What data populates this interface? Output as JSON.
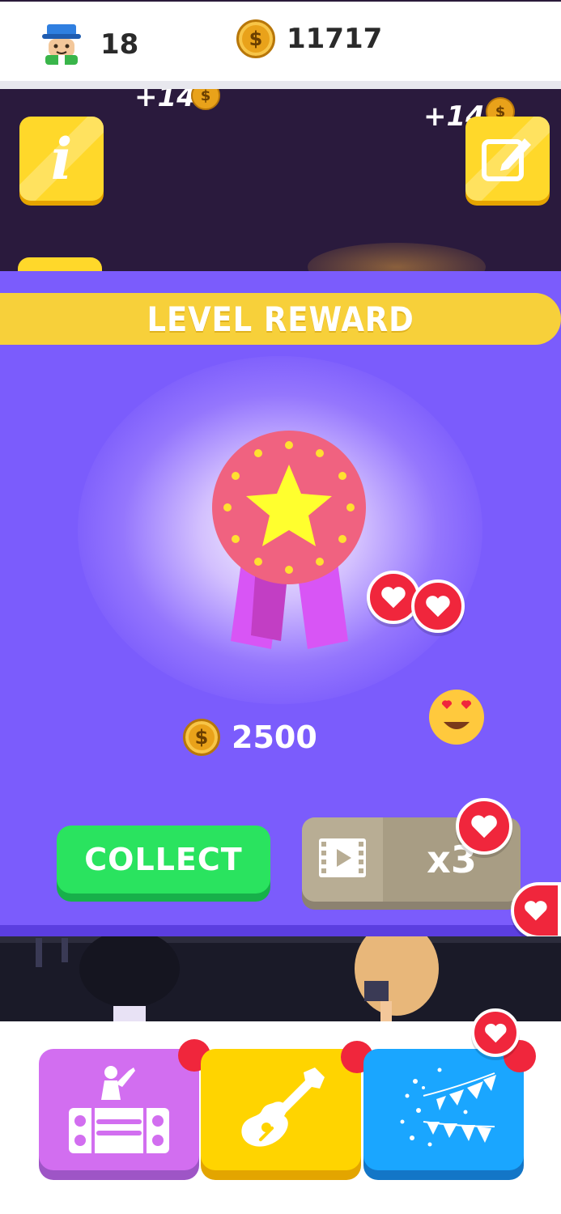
{
  "header": {
    "level_value": "18",
    "coin_value": "11717",
    "coin_symbol": "$"
  },
  "scene": {
    "floating_rewards": [
      "+14",
      "+14"
    ]
  },
  "modal": {
    "title": "LEVEL REWARD",
    "reward_amount": "2500",
    "collect_label": "COLLECT",
    "multiplier_label": "x3"
  },
  "dock": {
    "items": [
      {
        "name": "dj",
        "color": "#d26ef0",
        "has_notification": true
      },
      {
        "name": "guitar",
        "color": "#ffd400",
        "has_notification": true
      },
      {
        "name": "party",
        "color": "#1aa6ff",
        "has_notification": true
      }
    ]
  },
  "colors": {
    "modal_bg": "#7b5cfc",
    "banner": "#f7d03a",
    "collect": "#2ae35f",
    "heart": "#f0263c",
    "medal": "#f06280",
    "ribbon": "#d855f5"
  }
}
